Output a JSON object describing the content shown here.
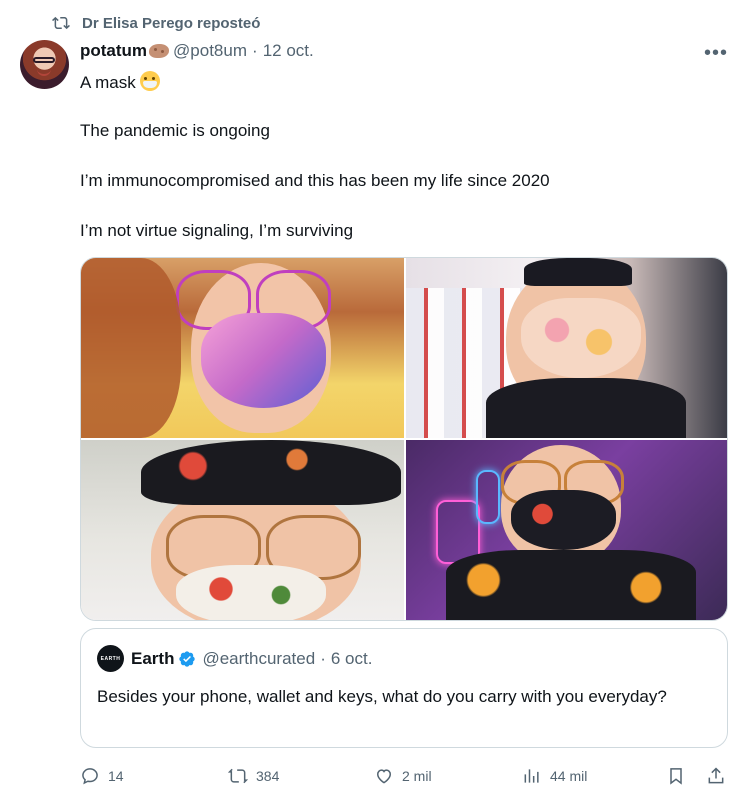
{
  "repost": {
    "label": "Dr Elisa Perego reposteó"
  },
  "tweet": {
    "author_name": "potatum",
    "author_handle": "@pot8um",
    "separator": "·",
    "date": "12 oct.",
    "lines": [
      "A mask",
      "The pandemic is ongoing",
      "I’m immunocompromised and this has been my life since 2020",
      "I’m not virtue signaling, I’m surviving"
    ],
    "more_label": "•••"
  },
  "quote": {
    "logo_text": "EARTH",
    "author_name": "Earth",
    "author_handle": "@earthcurated",
    "separator": "·",
    "date": "6 oct.",
    "text": "Besides your phone, wallet and keys, what do you carry with you everyday?"
  },
  "actions": {
    "replies": "14",
    "reposts": "384",
    "likes": "2 mil",
    "views": "44 mil"
  },
  "colors": {
    "secondary_text": "#536471",
    "repost_green": "#536471",
    "verified_blue": "#1d9bf0"
  }
}
